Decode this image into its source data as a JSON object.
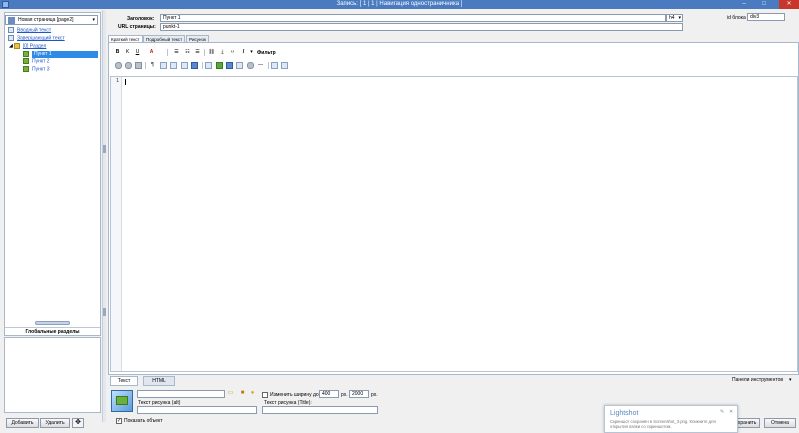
{
  "window": {
    "title": "Запись: [ 1 | 1 | Навигация одностраничника ]",
    "minimize": "–",
    "maximize": "□",
    "close": "✕"
  },
  "left_panel": {
    "page_select": "Новая страница [page2]",
    "tree": {
      "intro": "Вводный текст",
      "final": "Завершающий текст",
      "section": "[0] Раздел",
      "items": [
        "Пункт 1",
        "Пункт 2",
        "Пункт 3"
      ],
      "selected_index": 0
    },
    "globals_title": "Глобальные разделы",
    "add_button": "Добавить",
    "delete_button": "Удалить"
  },
  "form": {
    "title_label": "Заголовок:",
    "title_value": "Пункт 1",
    "heading_level": "h4",
    "url_label": "URL страницы:",
    "url_value": "punkt-1",
    "block_id_label": "id блока",
    "block_id_value": "div3"
  },
  "tabs": [
    "Краткий текст",
    "Подробный текст",
    "Рисунок"
  ],
  "active_tab": 0,
  "toolbar": {
    "bold": "B",
    "italic": "K",
    "underline": "U",
    "font_color": "A",
    "filter_label": "Фильтр"
  },
  "editor": {
    "line_numbers": [
      "1"
    ]
  },
  "bottom_tabs": [
    "Текст",
    "HTML"
  ],
  "active_bottom_tab": 0,
  "panels_label": "Панели инструментов",
  "image": {
    "alt_label": "Текст рисунка (alt)",
    "change_width_label": "Изменить ширину до:",
    "width_value": "400",
    "width_unit": "px.",
    "height_value": "2000",
    "height_unit": "px.",
    "title_label": "Текст рисунка (Title):",
    "show_object_label": "Показать объект",
    "show_object_checked": "✓"
  },
  "buttons": {
    "save": "Сохранить",
    "cancel": "Отмена"
  },
  "lightshot": {
    "title": "Lightshot",
    "body": "Скриншот сохранён в Screenshot_3.png. Кликните для открытия папки со скриншотом."
  }
}
